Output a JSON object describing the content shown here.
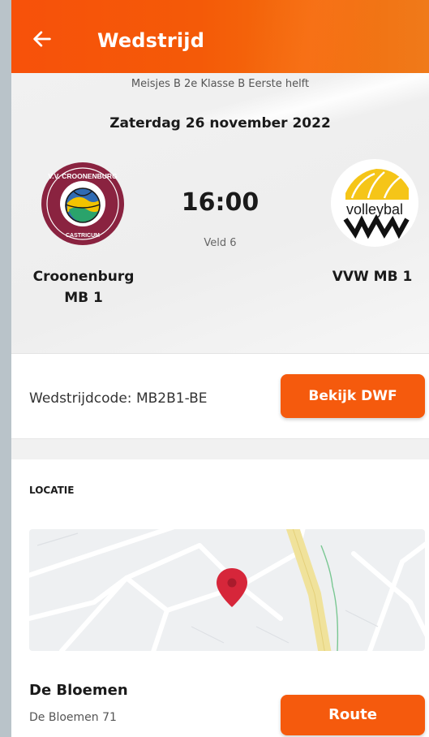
{
  "header": {
    "title": "Wedstrijd",
    "back_icon": "arrow-left-icon"
  },
  "match": {
    "league": "Meisjes B 2e Klasse B Eerste helft",
    "date": "Zaterdag 26 november 2022",
    "time": "16:00",
    "field": "Veld 6",
    "home_team": "Croonenburg MB 1",
    "away_team": "VVW MB 1",
    "home_logo_text": "V.V. CROONENBURG CASTRICUM",
    "away_logo_text": "volleybal VVW"
  },
  "code": {
    "label": "Wedstrijdcode: MB2B1-BE",
    "button": "Bekijk DWF"
  },
  "location": {
    "section_title": "LOCATIE",
    "name": "De Bloemen",
    "address": "De Bloemen 71",
    "route_button": "Route",
    "marker_icon": "map-pin-icon"
  },
  "colors": {
    "accent": "#f55a0d",
    "home_logo": "#8a2340",
    "map_marker": "#d6263a"
  }
}
